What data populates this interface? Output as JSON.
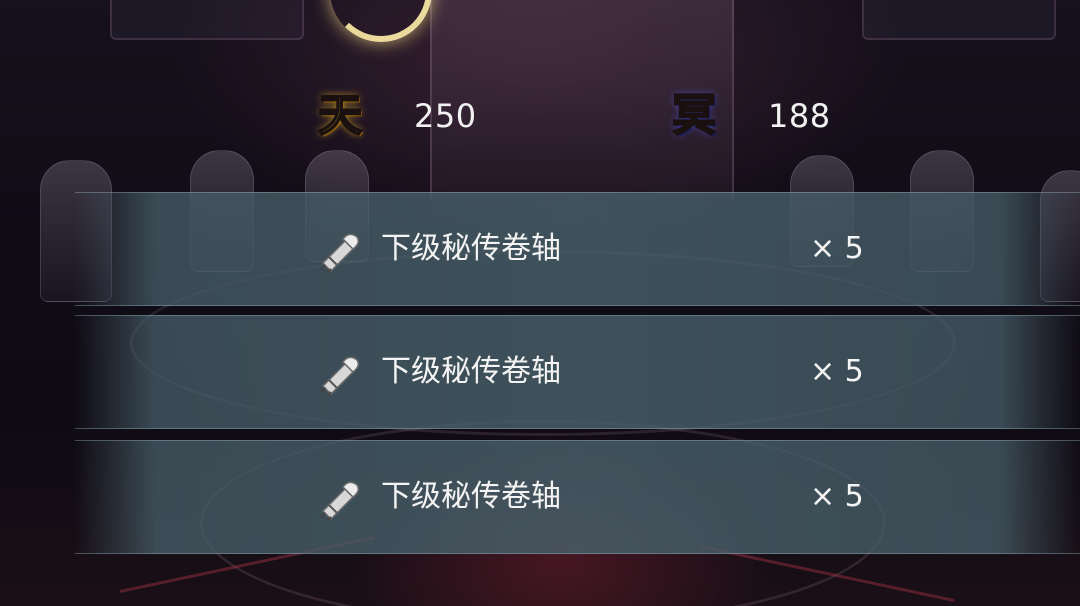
{
  "currencies": [
    {
      "glyph": "天",
      "value": "250",
      "color": "#ffd52e"
    },
    {
      "glyph": "冥",
      "value": "188",
      "color": "#4a52e8"
    }
  ],
  "rewards": [
    {
      "name": "下级秘传卷轴",
      "quantity": "× 5",
      "icon": "scroll-icon"
    },
    {
      "name": "下级秘传卷轴",
      "quantity": "× 5",
      "icon": "scroll-icon"
    },
    {
      "name": "下级秘传卷轴",
      "quantity": "× 5",
      "icon": "scroll-icon"
    }
  ]
}
